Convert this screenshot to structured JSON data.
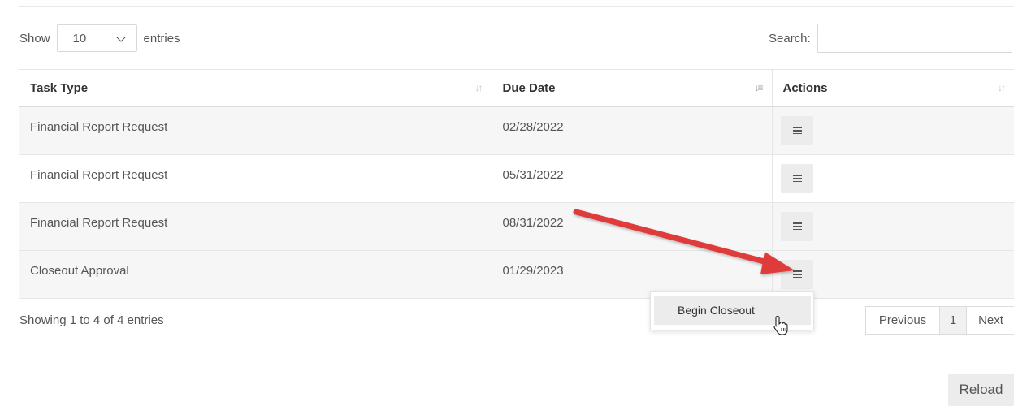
{
  "length_control": {
    "prefix": "Show",
    "selected": "10",
    "suffix": "entries"
  },
  "search": {
    "label": "Search:",
    "value": "",
    "placeholder": ""
  },
  "table": {
    "headers": [
      "Task Type",
      "Due Date",
      "Actions"
    ],
    "rows": [
      {
        "task_type": "Financial Report Request",
        "due_date": "02/28/2022",
        "action_icon": "menu-icon"
      },
      {
        "task_type": "Financial Report Request",
        "due_date": "05/31/2022",
        "action_icon": "menu-icon"
      },
      {
        "task_type": "Financial Report Request",
        "due_date": "08/31/2022",
        "action_icon": "menu-icon"
      },
      {
        "task_type": "Closeout Approval",
        "due_date": "01/29/2023",
        "action_icon": "menu-icon"
      }
    ],
    "sorted_column": "Due Date"
  },
  "info_text": "Showing 1 to 4 of 4 entries",
  "dropdown_menu": {
    "items": [
      "Begin Closeout"
    ]
  },
  "pagination": {
    "previous": "Previous",
    "current": "1",
    "next": "Next"
  },
  "reload_button": "Reload",
  "colors": {
    "annotation_arrow": "#e03a3a",
    "row_stripe": "#f6f6f6",
    "button_bg": "#ececec"
  }
}
